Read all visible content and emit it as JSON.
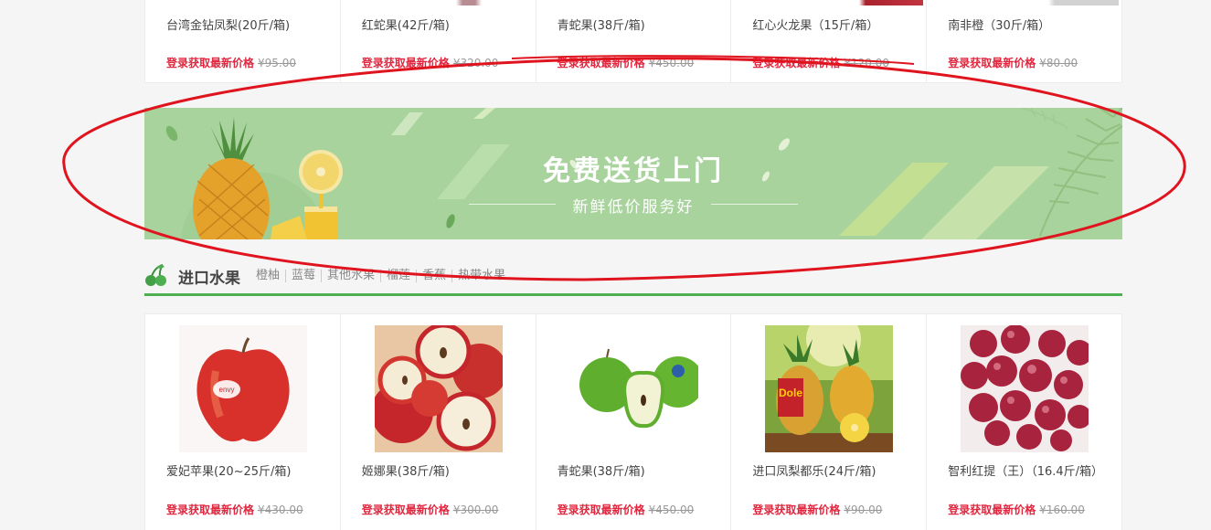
{
  "top_products": [
    {
      "name": "台湾金钻凤梨(20斤/箱)",
      "login_price": "登录获取最新价格",
      "old_price": "¥95.00",
      "peek_color": "#ffffff"
    },
    {
      "name": "红蛇果(42斤/箱)",
      "login_price": "登录获取最新价格",
      "old_price": "¥320.00",
      "peek_color": "#c89aa0"
    },
    {
      "name": "青蛇果(38斤/箱)",
      "login_price": "登录获取最新价格",
      "old_price": "¥450.00",
      "peek_color": "#ffffff"
    },
    {
      "name": "红心火龙果（15斤/箱）",
      "login_price": "登录获取最新价格",
      "old_price": "¥120.00",
      "peek_color": "#b0303a"
    },
    {
      "name": "南非橙（30斤/箱）",
      "login_price": "登录获取最新价格",
      "old_price": "¥80.00",
      "peek_color": "#d8d8d8"
    }
  ],
  "banner": {
    "title": "免费送货上门",
    "subtitle": "新鲜低价服务好"
  },
  "section": {
    "icon": "cherry-icon",
    "title": "进口水果",
    "tags": [
      "橙柚",
      "蓝莓",
      "其他水果",
      "榴莲",
      "香蕉",
      "热带水果"
    ],
    "accent_color": "#4caf50"
  },
  "products": [
    {
      "name": "爱妃苹果(20~25斤/箱)",
      "login_price": "登录获取最新价格",
      "old_price": "¥430.00",
      "image": "red-apple-image"
    },
    {
      "name": "姬娜果(38斤/箱)",
      "login_price": "登录获取最新价格",
      "old_price": "¥300.00",
      "image": "sliced-apples-image"
    },
    {
      "name": "青蛇果(38斤/箱)",
      "login_price": "登录获取最新价格",
      "old_price": "¥450.00",
      "image": "green-apples-image"
    },
    {
      "name": "进口凤梨都乐(24斤/箱)",
      "login_price": "登录获取最新价格",
      "old_price": "¥90.00",
      "image": "pineapple-image"
    },
    {
      "name": "智利红提（王）（16.4斤/箱）",
      "login_price": "登录获取最新价格",
      "old_price": "¥160.00",
      "image": "red-grapes-image"
    }
  ],
  "colors": {
    "price_red": "#e0273f",
    "banner_green": "#a8d39d",
    "annotation_red": "#e0141e"
  }
}
